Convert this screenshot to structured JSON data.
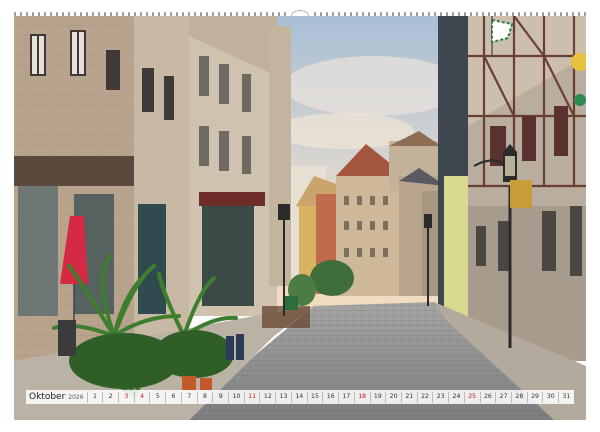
{
  "calendar": {
    "month": "Oktober",
    "year": "2026",
    "days": [
      {
        "n": "1",
        "red": false
      },
      {
        "n": "2",
        "red": false
      },
      {
        "n": "3",
        "red": true
      },
      {
        "n": "4",
        "red": true
      },
      {
        "n": "5",
        "red": false
      },
      {
        "n": "6",
        "red": false
      },
      {
        "n": "7",
        "red": false
      },
      {
        "n": "8",
        "red": false
      },
      {
        "n": "9",
        "red": false
      },
      {
        "n": "10",
        "red": false
      },
      {
        "n": "11",
        "red": true
      },
      {
        "n": "12",
        "red": false
      },
      {
        "n": "13",
        "red": false
      },
      {
        "n": "14",
        "red": false
      },
      {
        "n": "15",
        "red": false
      },
      {
        "n": "16",
        "red": false
      },
      {
        "n": "17",
        "red": false
      },
      {
        "n": "18",
        "red": true
      },
      {
        "n": "19",
        "red": false
      },
      {
        "n": "20",
        "red": false
      },
      {
        "n": "21",
        "red": false
      },
      {
        "n": "22",
        "red": false
      },
      {
        "n": "23",
        "red": false
      },
      {
        "n": "24",
        "red": false
      },
      {
        "n": "25",
        "red": true
      },
      {
        "n": "26",
        "red": false
      },
      {
        "n": "27",
        "red": false
      },
      {
        "n": "28",
        "red": false
      },
      {
        "n": "29",
        "red": false
      },
      {
        "n": "30",
        "red": false
      },
      {
        "n": "31",
        "red": false
      }
    ]
  },
  "colors": {
    "sunday": "#c2161b",
    "weekday": "#333333",
    "sky": "#c9d8e6",
    "cobblestone": "#8d8f94"
  },
  "photo": {
    "icons": [
      "street-lamp-icon",
      "parasol-icon",
      "palm-plant-icon",
      "flag-icon"
    ]
  }
}
